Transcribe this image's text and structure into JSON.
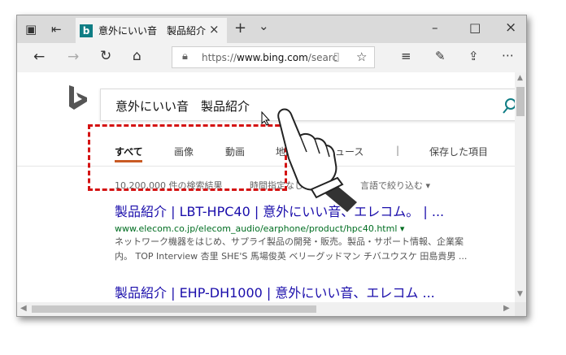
{
  "browser": {
    "tab_title": "意外にいい音　製品紹介",
    "tab_close": "×",
    "new_tab": "+",
    "tab_menu": "⌄",
    "win_min": "–",
    "win_max": "□",
    "win_close": "×",
    "address_prefix": "https://",
    "address_domain": "www.bing.com",
    "address_rest": "/searc"
  },
  "search": {
    "query": "意外にいい音　製品紹介",
    "tabs": [
      "すべて",
      "画像",
      "動画",
      "地図",
      "ニュース",
      "|",
      "保存した項目"
    ],
    "result_count": "10,200,000 件の検索結果",
    "time_filter": "時間指定なし ▾",
    "lang_filter": "言語で絞り込む ▾"
  },
  "results": [
    {
      "title": "製品紹介 | LBT-HPC40 | 意外にいい音、エレコム。 | ...",
      "url": "www.elecom.co.jp/elecom_audio/earphone/product/hpc40.html ▾",
      "snippet1": "ネットワーク機器をはじめ、サプライ製品の開発・販売。製品・サポート情報、企業案",
      "snippet2": "内。 TOP Interview 杏里 SHE'S 馬場俊英 ベリーグッドマン チバユウスケ 田島貴男 ..."
    },
    {
      "title": "製品紹介 | EHP-DH1000 | 意外にいい音、エレコム ..."
    }
  ],
  "colors": {
    "callout": "#d41313",
    "link": "#1a0dab",
    "url": "#006d21",
    "active_tab": "#c95b24"
  }
}
